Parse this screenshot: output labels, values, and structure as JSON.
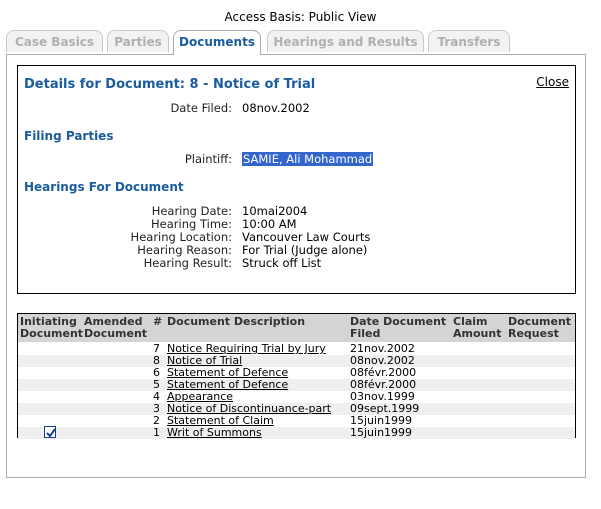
{
  "access_basis": "Access Basis: Public View",
  "tabs": [
    {
      "label": "Case Basics",
      "active": false
    },
    {
      "label": "Parties",
      "active": false
    },
    {
      "label": "Documents",
      "active": true
    },
    {
      "label": "Hearings and Results",
      "active": false
    },
    {
      "label": "Transfers",
      "active": false
    }
  ],
  "details": {
    "title": "Details for Document: 8 - Notice of Trial",
    "close_label": "Close",
    "date_filed_label": "Date Filed:",
    "date_filed": "08nov.2002",
    "filing_parties_heading": "Filing Parties",
    "plaintiff_label": "Plaintiff:",
    "plaintiff": "SAMIE, Ali Mohammad",
    "hearings_heading": "Hearings For Document",
    "hearing": {
      "date_label": "Hearing Date:",
      "date": "10mai2004",
      "time_label": "Hearing Time:",
      "time": "10:00 AM",
      "location_label": "Hearing Location:",
      "location": "Vancouver Law Courts",
      "reason_label": "Hearing Reason:",
      "reason": "For Trial (Judge alone)",
      "result_label": "Hearing Result:",
      "result": "Struck off List"
    }
  },
  "table": {
    "headers": {
      "initiating_1": "Initiating",
      "initiating_2": "Document",
      "amended_1": "Amended",
      "amended_2": "Document",
      "num": "#",
      "desc": "Document Description",
      "date_1": "Date Document",
      "date_2": "Filed",
      "claim_1": "Claim",
      "claim_2": "Amount",
      "req_1": "Document",
      "req_2": "Request"
    },
    "rows": [
      {
        "num": "7",
        "desc": "Notice Requiring Trial by Jury",
        "date": "21nov.2002"
      },
      {
        "num": "8",
        "desc": "Notice of Trial",
        "date": "08nov.2002"
      },
      {
        "num": "6",
        "desc": "Statement of Defence",
        "date": "08févr.2000"
      },
      {
        "num": "5",
        "desc": "Statement of Defence",
        "date": "08févr.2000"
      },
      {
        "num": "4",
        "desc": "Appearance",
        "date": "03nov.1999"
      },
      {
        "num": "3",
        "desc": "Notice of Discontinuance-part",
        "date": "09sept.1999"
      },
      {
        "num": "2",
        "desc": "Statement of Claim",
        "date": "15juin1999"
      },
      {
        "num": "1",
        "desc": "Writ of Summons",
        "date": "15juin1999",
        "initiating": true
      }
    ]
  }
}
